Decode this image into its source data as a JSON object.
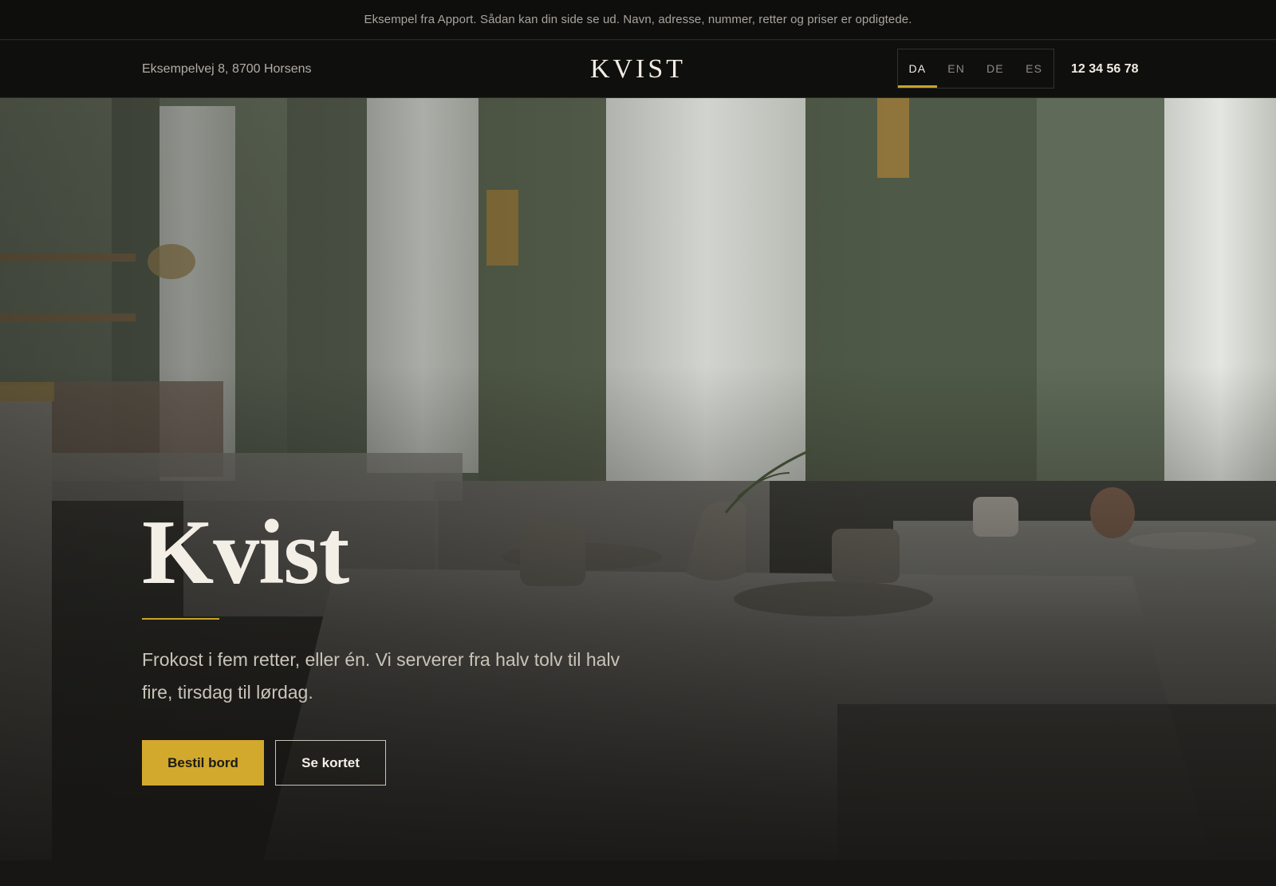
{
  "notice": {
    "text": "Eksempel fra Apport. Sådan kan din side se ud. Navn, adresse, nummer, retter og priser er opdigtede."
  },
  "header": {
    "address": "Eksempelvej 8, 8700 Horsens",
    "logo": "KVIST",
    "languages": [
      {
        "code": "DA",
        "active": true
      },
      {
        "code": "EN",
        "active": false
      },
      {
        "code": "DE",
        "active": false
      },
      {
        "code": "ES",
        "active": false
      }
    ],
    "phone": "12 34 56 78"
  },
  "hero": {
    "title": "Kvist",
    "text": "Frokost i fem retter, eller én. Vi serverer fra halv tolv til halv fire, tirsdag til lørdag.",
    "primary_button": "Bestil bord",
    "secondary_button": "Se kortet"
  },
  "colors": {
    "accent": "#d2a92c",
    "background": "#0f0f0e",
    "text_light": "#f1ece1"
  }
}
